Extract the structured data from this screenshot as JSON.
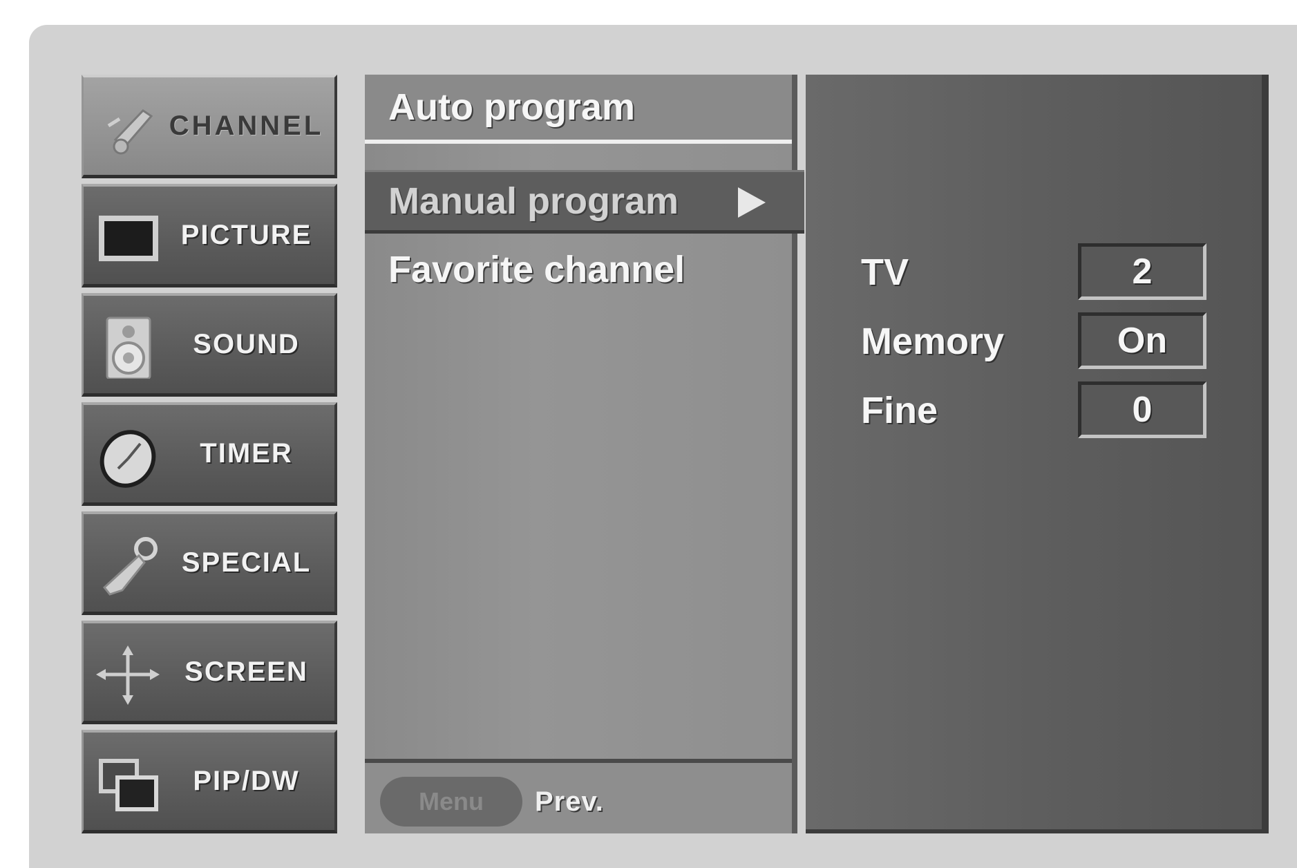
{
  "categories": [
    {
      "label": "CHANNEL",
      "icon": "channel-icon",
      "active": true
    },
    {
      "label": "PICTURE",
      "icon": "picture-icon",
      "active": false
    },
    {
      "label": "SOUND",
      "icon": "speaker-icon",
      "active": false
    },
    {
      "label": "TIMER",
      "icon": "clock-icon",
      "active": false
    },
    {
      "label": "SPECIAL",
      "icon": "key-icon",
      "active": false
    },
    {
      "label": "SCREEN",
      "icon": "move-arrows-icon",
      "active": false
    },
    {
      "label": "PIP/DW",
      "icon": "pip-icon",
      "active": false
    }
  ],
  "submenu": {
    "items": [
      {
        "label": "Auto program"
      },
      {
        "label": "Manual program",
        "selected": true
      },
      {
        "label": "Favorite channel"
      }
    ],
    "footer": {
      "menu_button_label": "Menu",
      "prev_label": "Prev."
    }
  },
  "settings": [
    {
      "label": "TV",
      "value": "2"
    },
    {
      "label": "Memory",
      "value": "On"
    },
    {
      "label": "Fine",
      "value": "0"
    }
  ],
  "colors": {
    "background": "#ffffff",
    "frame": "#d2d2d2",
    "active_category": "#939393",
    "category": "#5c5c5c",
    "submenu_panel": "#8f8f8f",
    "submenu_selected": "#5d5d5d",
    "value_panel": "#5e5e5e",
    "text": "#f6f6f6"
  }
}
